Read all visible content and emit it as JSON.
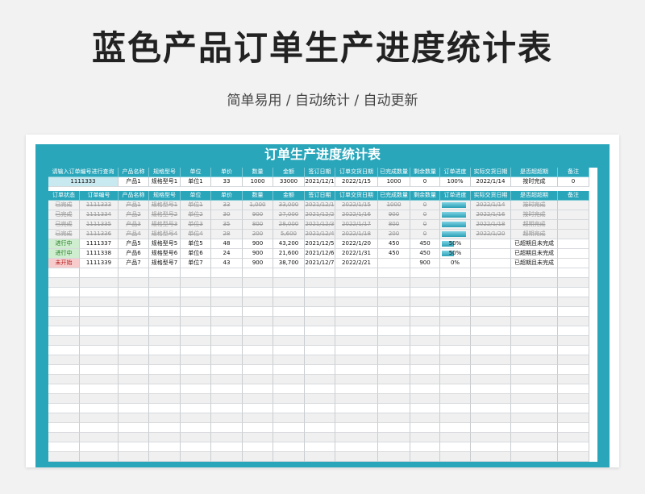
{
  "page": {
    "title": "蓝色产品订单生产进度统计表",
    "subtitle": "简单易用 / 自动统计 / 自动更新"
  },
  "sheet": {
    "title": "订单生产进度统计表",
    "query_headers": [
      "请输入订单编号进行查询",
      "产品名称",
      "规格型号",
      "单位",
      "单价",
      "数量",
      "金额",
      "签订日期",
      "订单交货日期",
      "已完成数量",
      "剩余数量",
      "订单进度",
      "实际交货日期",
      "是否超超期",
      "备注"
    ],
    "query_row": [
      "1111333",
      "产品1",
      "规格型号1",
      "单位1",
      "33",
      "1000",
      "33000",
      "2021/12/1",
      "2022/1/15",
      "1000",
      "0",
      "100%",
      "2022/1/14",
      "按时完成",
      "0"
    ],
    "headers": [
      "订单状态",
      "订单编号",
      "产品名称",
      "规格型号",
      "单位",
      "单价",
      "数量",
      "金额",
      "签订日期",
      "订单交货日期",
      "已完成数量",
      "剩余数量",
      "订单进度",
      "实际交货日期",
      "是否超超期",
      "备注"
    ],
    "rows": [
      {
        "kind": "done",
        "cells": [
          "已完成",
          "1111333",
          "产品1",
          "规格型号1",
          "单位1",
          "33",
          "1,000",
          "33,000",
          "2021/12/1",
          "2022/1/15",
          "1000",
          "0",
          "",
          "2022/1/14",
          "按时完成",
          ""
        ],
        "progress": 1.0
      },
      {
        "kind": "done",
        "cells": [
          "已完成",
          "1111334",
          "产品2",
          "规格型号2",
          "单位2",
          "30",
          "900",
          "27,000",
          "2021/12/2",
          "2022/1/16",
          "900",
          "0",
          "",
          "2022/1/16",
          "按时完成",
          ""
        ],
        "progress": 1.0
      },
      {
        "kind": "done",
        "cells": [
          "已完成",
          "1111335",
          "产品3",
          "规格型号3",
          "单位3",
          "35",
          "800",
          "28,000",
          "2021/12/3",
          "2022/1/17",
          "800",
          "0",
          "",
          "2022/1/18",
          "超期完成",
          ""
        ],
        "progress": 1.0
      },
      {
        "kind": "done",
        "cells": [
          "已完成",
          "1111336",
          "产品4",
          "规格型号4",
          "单位4",
          "28",
          "200",
          "5,600",
          "2021/12/4",
          "2022/1/18",
          "200",
          "0",
          "",
          "2022/1/20",
          "超期完成",
          ""
        ],
        "progress": 1.0
      },
      {
        "kind": "run",
        "cells": [
          "进行中",
          "1111337",
          "产品5",
          "规格型号5",
          "单位5",
          "48",
          "900",
          "43,200",
          "2021/12/5",
          "2022/1/20",
          "450",
          "450",
          "50%",
          "",
          "已超期且未完成",
          ""
        ],
        "progress": 0.5
      },
      {
        "kind": "run",
        "cells": [
          "进行中",
          "1111338",
          "产品6",
          "规格型号6",
          "单位6",
          "24",
          "900",
          "21,600",
          "2021/12/6",
          "2022/1/31",
          "450",
          "450",
          "50%",
          "",
          "已超期且未完成",
          ""
        ],
        "progress": 0.5
      },
      {
        "kind": "new",
        "cells": [
          "未开始",
          "1111339",
          "产品7",
          "规格型号7",
          "单位7",
          "43",
          "900",
          "38,700",
          "2021/12/7",
          "2022/2/21",
          "",
          "900",
          "0%",
          "",
          "已超期且未完成",
          ""
        ],
        "progress": 0.0
      }
    ],
    "empty_rows": 20,
    "colors": {
      "accent": "#2aa6bb",
      "key_cell": "#c8e9f0",
      "running": "#cfeecf",
      "not_started": "#f8cccc"
    }
  }
}
